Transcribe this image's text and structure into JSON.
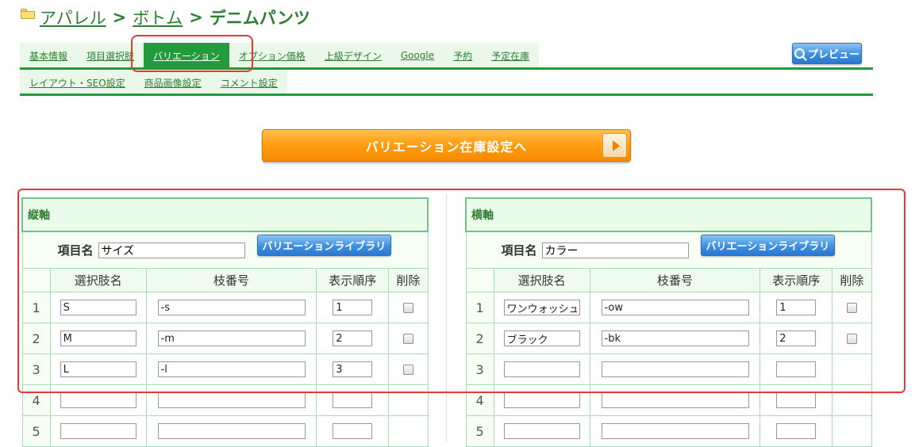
{
  "breadcrumb": {
    "items": [
      "アパレル",
      "ボトム"
    ],
    "separator": ">",
    "current": "デニムパンツ"
  },
  "tabs": {
    "row1": [
      {
        "label": "基本情報",
        "active": false
      },
      {
        "label": "項目選択肢",
        "active": false
      },
      {
        "label": "バリエーション",
        "active": true
      },
      {
        "label": "オプション価格",
        "active": false
      },
      {
        "label": "上級デザイン",
        "active": false
      },
      {
        "label": "Google",
        "active": false
      },
      {
        "label": "予約",
        "active": false
      },
      {
        "label": "予定在庫",
        "active": false
      }
    ],
    "row2": [
      {
        "label": "レイアウト・SEO設定",
        "active": false
      },
      {
        "label": "商品画像設定",
        "active": false
      },
      {
        "label": "コメント設定",
        "active": false
      }
    ]
  },
  "preview_button": {
    "label": "プレビュー",
    "icon": "magnifier-icon"
  },
  "stock_button": {
    "label": "バリエーション在庫設定へ",
    "icon": "arrow-right-icon"
  },
  "colors": {
    "green": "#239a3b",
    "orange": "#ff9c10",
    "blue": "#3d8fe0",
    "highlight_red": "#e53935"
  },
  "columns": {
    "name": "選択肢名",
    "branch": "枝番号",
    "order": "表示順序",
    "delete": "削除"
  },
  "vertical_axis": {
    "title": "縦軸",
    "item_name_label": "項目名",
    "item_name_value": "サイズ",
    "library_button": "バリエーションライブラリ",
    "rows": [
      {
        "num": "1",
        "name": "S",
        "branch": "-s",
        "order": "1",
        "checkbox": true
      },
      {
        "num": "2",
        "name": "M",
        "branch": "-m",
        "order": "2",
        "checkbox": true
      },
      {
        "num": "3",
        "name": "L",
        "branch": "-l",
        "order": "3",
        "checkbox": true
      },
      {
        "num": "4",
        "name": "",
        "branch": "",
        "order": "",
        "checkbox": false
      },
      {
        "num": "5",
        "name": "",
        "branch": "",
        "order": "",
        "checkbox": false
      }
    ]
  },
  "horizontal_axis": {
    "title": "横軸",
    "item_name_label": "項目名",
    "item_name_value": "カラー",
    "library_button": "バリエーションライブラリ",
    "rows": [
      {
        "num": "1",
        "name": "ワンウォッシュ",
        "branch": "-ow",
        "order": "1",
        "checkbox": true
      },
      {
        "num": "2",
        "name": "ブラック",
        "branch": "-bk",
        "order": "2",
        "checkbox": true
      },
      {
        "num": "3",
        "name": "",
        "branch": "",
        "order": "",
        "checkbox": false
      },
      {
        "num": "4",
        "name": "",
        "branch": "",
        "order": "",
        "checkbox": false
      },
      {
        "num": "5",
        "name": "",
        "branch": "",
        "order": "",
        "checkbox": false
      }
    ]
  }
}
